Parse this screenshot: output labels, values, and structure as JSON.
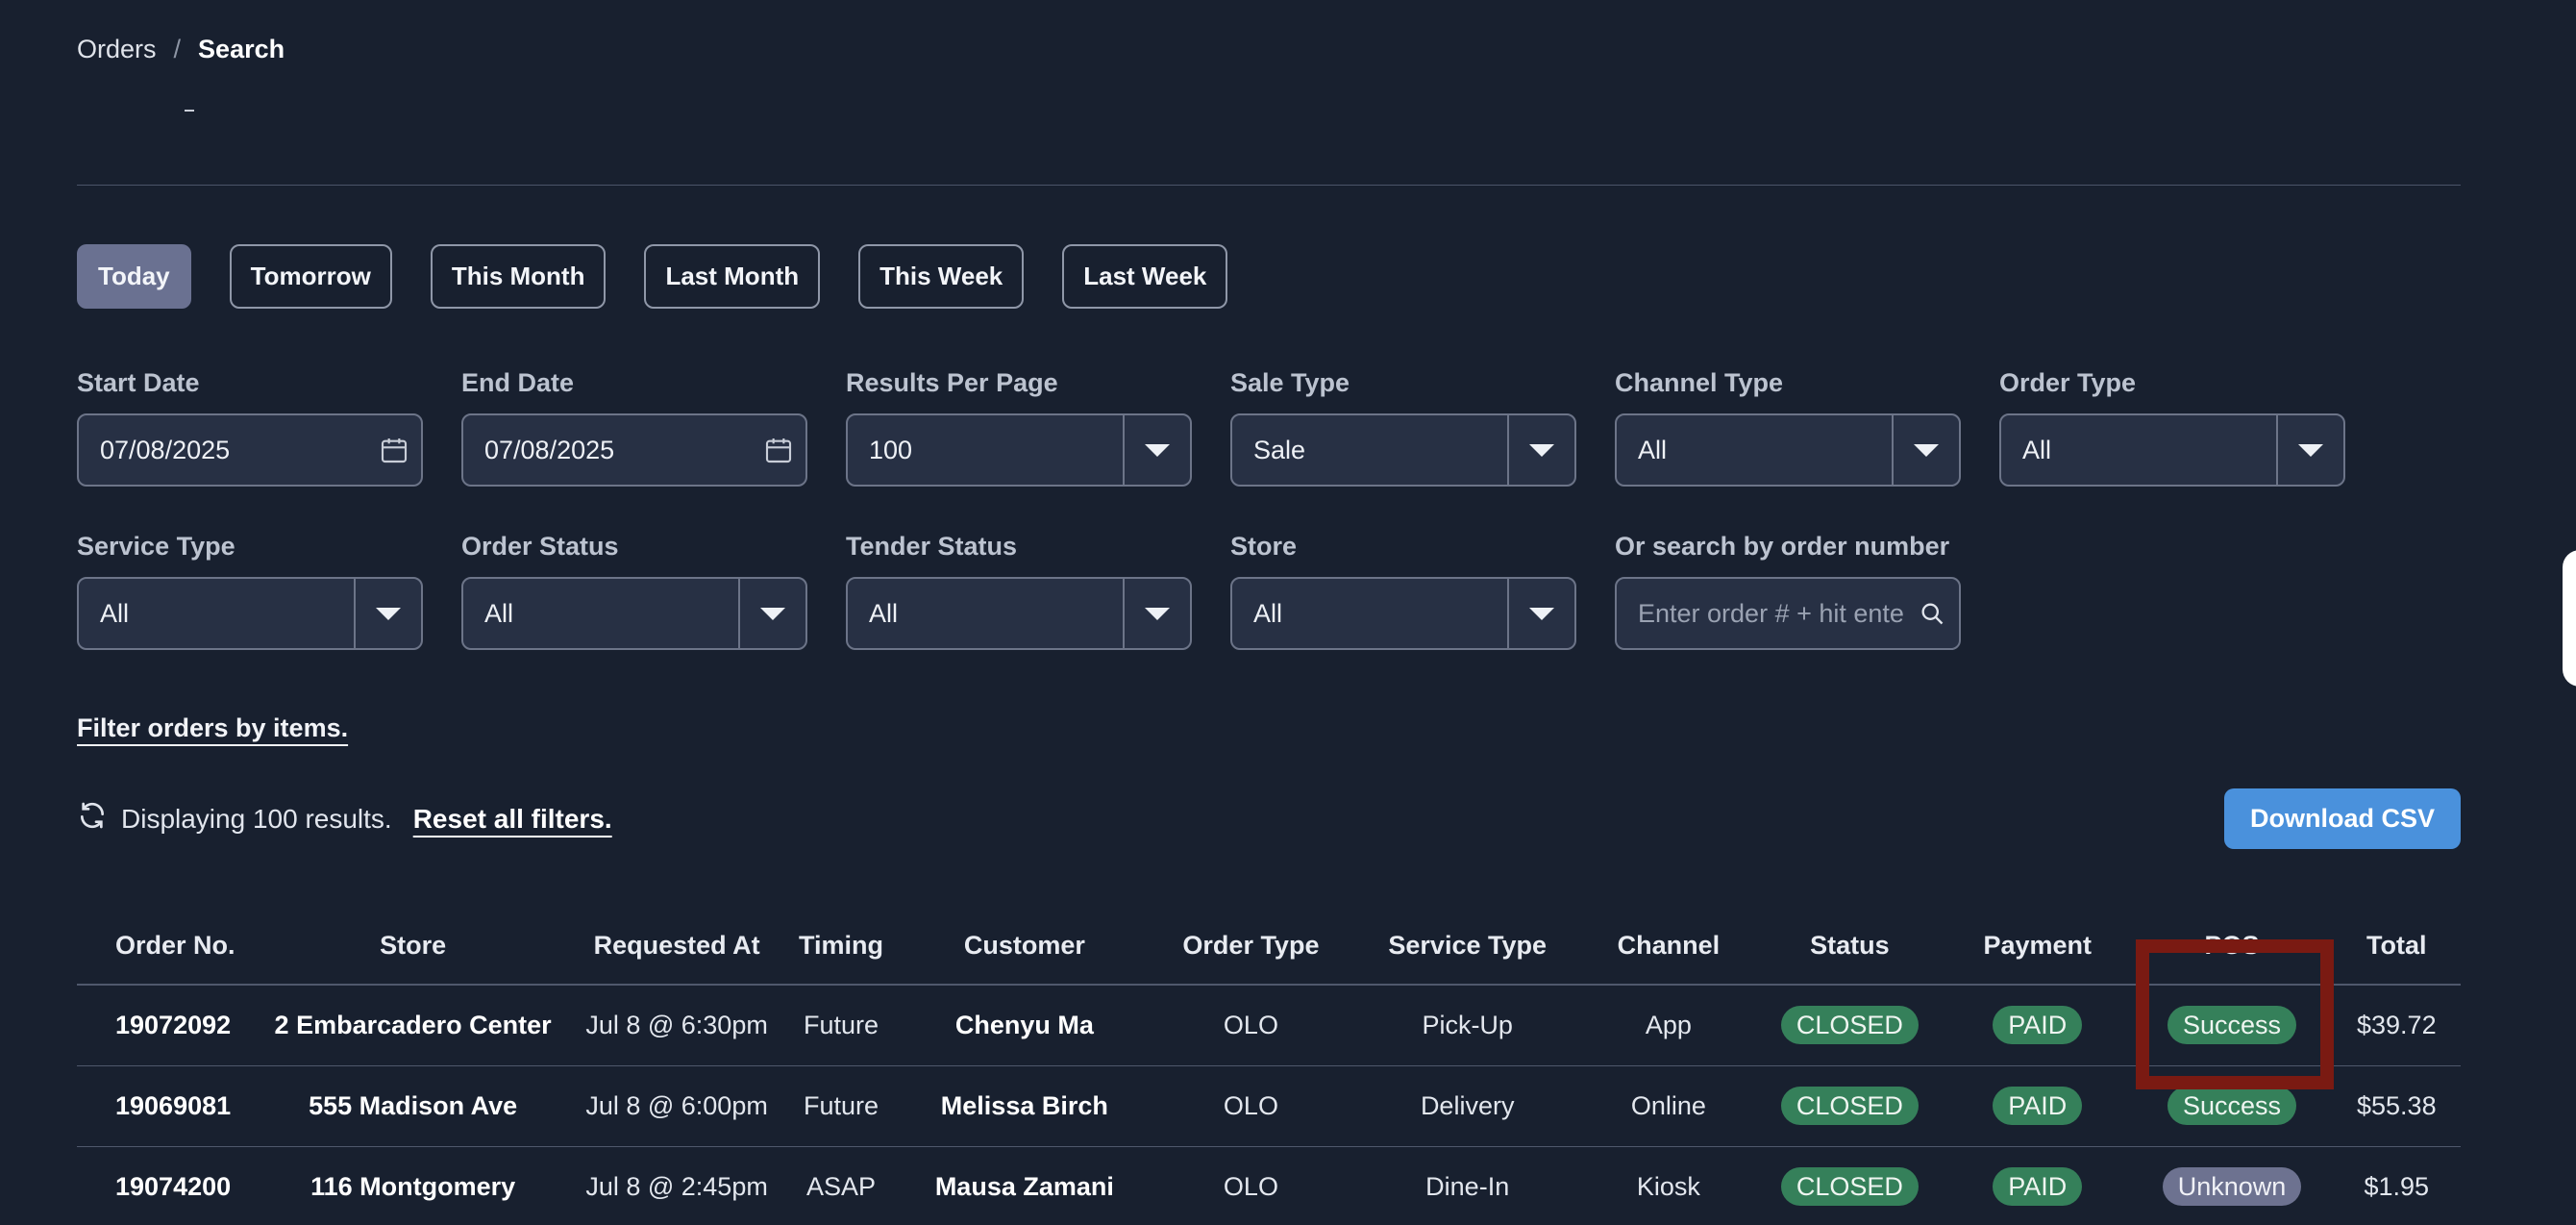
{
  "breadcrumb": {
    "parent": "Orders",
    "separator": "/",
    "current": "Search"
  },
  "quick_ranges": [
    {
      "label": "Today",
      "active": true
    },
    {
      "label": "Tomorrow",
      "active": false
    },
    {
      "label": "This Month",
      "active": false
    },
    {
      "label": "Last Month",
      "active": false
    },
    {
      "label": "This Week",
      "active": false
    },
    {
      "label": "Last Week",
      "active": false
    }
  ],
  "filters": {
    "start_date": {
      "label": "Start Date",
      "value": "07/08/2025"
    },
    "end_date": {
      "label": "End Date",
      "value": "07/08/2025"
    },
    "results_per_page": {
      "label": "Results Per Page",
      "value": "100"
    },
    "sale_type": {
      "label": "Sale Type",
      "value": "Sale"
    },
    "channel_type": {
      "label": "Channel Type",
      "value": "All"
    },
    "order_type": {
      "label": "Order Type",
      "value": "All"
    },
    "service_type": {
      "label": "Service Type",
      "value": "All"
    },
    "order_status": {
      "label": "Order Status",
      "value": "All"
    },
    "tender_status": {
      "label": "Tender Status",
      "value": "All"
    },
    "store": {
      "label": "Store",
      "value": "All"
    },
    "order_search": {
      "label": "Or search by order number",
      "placeholder": "Enter order # + hit enter"
    }
  },
  "filter_items_link": "Filter orders by items.",
  "results": {
    "count_text": "Displaying 100 results.",
    "reset_link": "Reset all filters."
  },
  "download_button": "Download CSV",
  "table": {
    "columns": [
      "Order No.",
      "Store",
      "Requested At",
      "Timing",
      "Customer",
      "Order Type",
      "Service Type",
      "Channel",
      "Status",
      "Payment",
      "POS",
      "Total"
    ],
    "rows": [
      {
        "order_no": "19072092",
        "store": "2 Embarcadero Center",
        "requested_at": "Jul 8 @ 6:30pm",
        "timing": "Future",
        "customer": "Chenyu Ma",
        "order_type": "OLO",
        "service_type": "Pick-Up",
        "channel": "App",
        "status": "CLOSED",
        "payment": "PAID",
        "pos": "Success",
        "total": "$39.72"
      },
      {
        "order_no": "19069081",
        "store": "555 Madison Ave",
        "requested_at": "Jul 8 @ 6:00pm",
        "timing": "Future",
        "customer": "Melissa Birch",
        "order_type": "OLO",
        "service_type": "Delivery",
        "channel": "Online",
        "status": "CLOSED",
        "payment": "PAID",
        "pos": "Success",
        "total": "$55.38"
      },
      {
        "order_no": "19074200",
        "store": "116 Montgomery",
        "requested_at": "Jul 8 @ 2:45pm",
        "timing": "ASAP",
        "customer": "Mausa Zamani",
        "order_type": "OLO",
        "service_type": "Dine-In",
        "channel": "Kiosk",
        "status": "CLOSED",
        "payment": "PAID",
        "pos": "Unknown",
        "total": "$1.95"
      }
    ]
  },
  "colors": {
    "background": "#18202f",
    "accent_blue": "#4a91dc",
    "status_green": "#35805a",
    "unknown_gray": "#6d7290",
    "highlight": "#7a1a12"
  },
  "icons": {
    "calendar": "calendar-icon",
    "search": "search-icon",
    "refresh": "refresh-icon",
    "dropdown": "chevron-down-icon"
  }
}
